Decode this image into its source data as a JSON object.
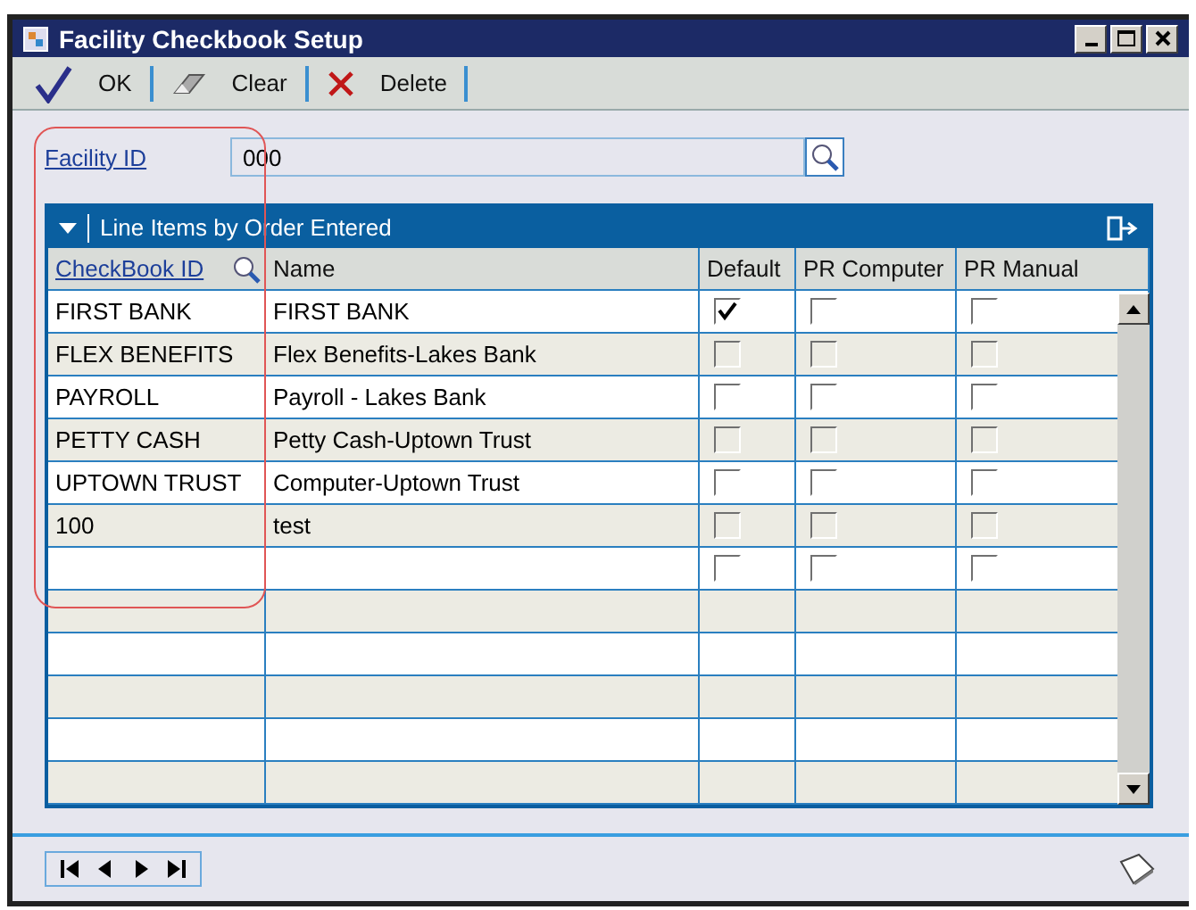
{
  "window": {
    "title": "Facility Checkbook Setup"
  },
  "toolbar": [
    {
      "kind": "ok",
      "label": "OK"
    },
    {
      "kind": "clear",
      "label": "Clear"
    },
    {
      "kind": "delete",
      "label": "Delete"
    }
  ],
  "facility": {
    "label": "Facility ID",
    "value": "000"
  },
  "grid": {
    "title": "Line Items by Order Entered",
    "columns": [
      "CheckBook ID",
      "Name",
      "Default",
      "PR Computer",
      "PR Manual"
    ],
    "rows": [
      {
        "id": "FIRST BANK",
        "name": "FIRST BANK",
        "default": true,
        "pr_computer": false,
        "pr_manual": false
      },
      {
        "id": "FLEX BENEFITS",
        "name": "Flex Benefits-Lakes Bank",
        "default": false,
        "pr_computer": false,
        "pr_manual": false
      },
      {
        "id": "PAYROLL",
        "name": "Payroll - Lakes Bank",
        "default": false,
        "pr_computer": false,
        "pr_manual": false
      },
      {
        "id": "PETTY CASH",
        "name": "Petty Cash-Uptown Trust",
        "default": false,
        "pr_computer": false,
        "pr_manual": false
      },
      {
        "id": "UPTOWN TRUST",
        "name": "Computer-Uptown Trust",
        "default": false,
        "pr_computer": false,
        "pr_manual": false
      },
      {
        "id": "100",
        "name": "test",
        "default": false,
        "pr_computer": false,
        "pr_manual": false
      },
      {
        "default": false,
        "pr_computer": false,
        "pr_manual": false
      }
    ]
  }
}
